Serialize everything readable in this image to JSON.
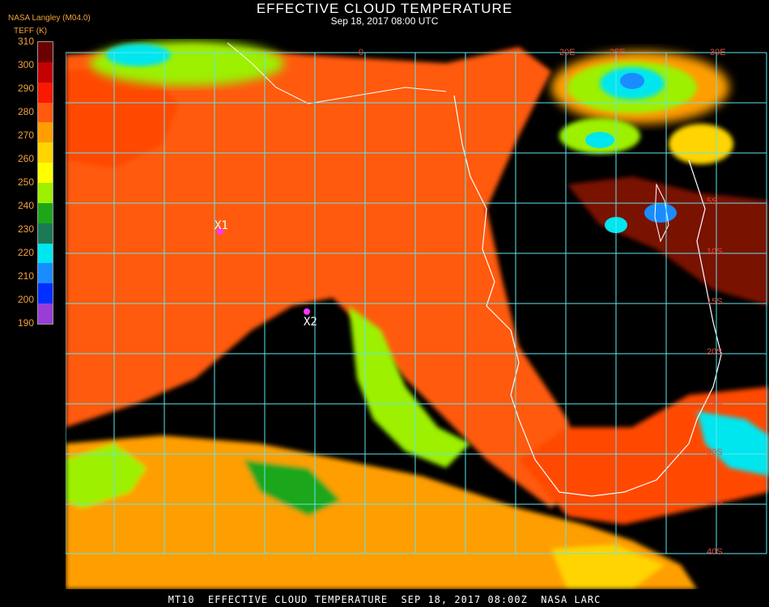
{
  "header": {
    "title": "EFFECTIVE CLOUD TEMPERATURE",
    "subtitle": "Sep 18, 2017 08:00 UTC",
    "source": "NASA Langley (M04.0)",
    "unit_label": "TEFF (K)"
  },
  "colorbar": {
    "ticks": [
      "310",
      "300",
      "290",
      "280",
      "270",
      "260",
      "250",
      "240",
      "230",
      "220",
      "210",
      "200",
      "190"
    ],
    "colors": [
      "#6a0000",
      "#c40000",
      "#f71a00",
      "#ff5a10",
      "#ff9e00",
      "#ffd400",
      "#ffff00",
      "#9cf000",
      "#1ea61a",
      "#1a7a55",
      "#00e6ee",
      "#1a8cff",
      "#0030ff",
      "#9a3cd6"
    ]
  },
  "map": {
    "latitude_labels": [
      "0",
      "5S",
      "10S",
      "15S",
      "20S",
      "25S",
      "30S",
      "35S",
      "40S"
    ],
    "longitude_labels": [
      "20E",
      "25E",
      "30E"
    ],
    "markers": [
      {
        "label": "X1",
        "color": "#ff33ff"
      },
      {
        "label": "X2",
        "color": "#ff33ff"
      }
    ],
    "colors": {
      "grid": "#5fe6ee",
      "coast": "#ffffff",
      "clear_ocean": "#000000",
      "warm_land": "#ff5a10",
      "stratus": "#ff9e00",
      "marker": "#ff33ff",
      "label": "#e04a3a"
    }
  },
  "footer": {
    "text": "MT10  EFFECTIVE CLOUD TEMPERATURE  SEP 18, 2017 08:00Z  NASA LARC"
  }
}
